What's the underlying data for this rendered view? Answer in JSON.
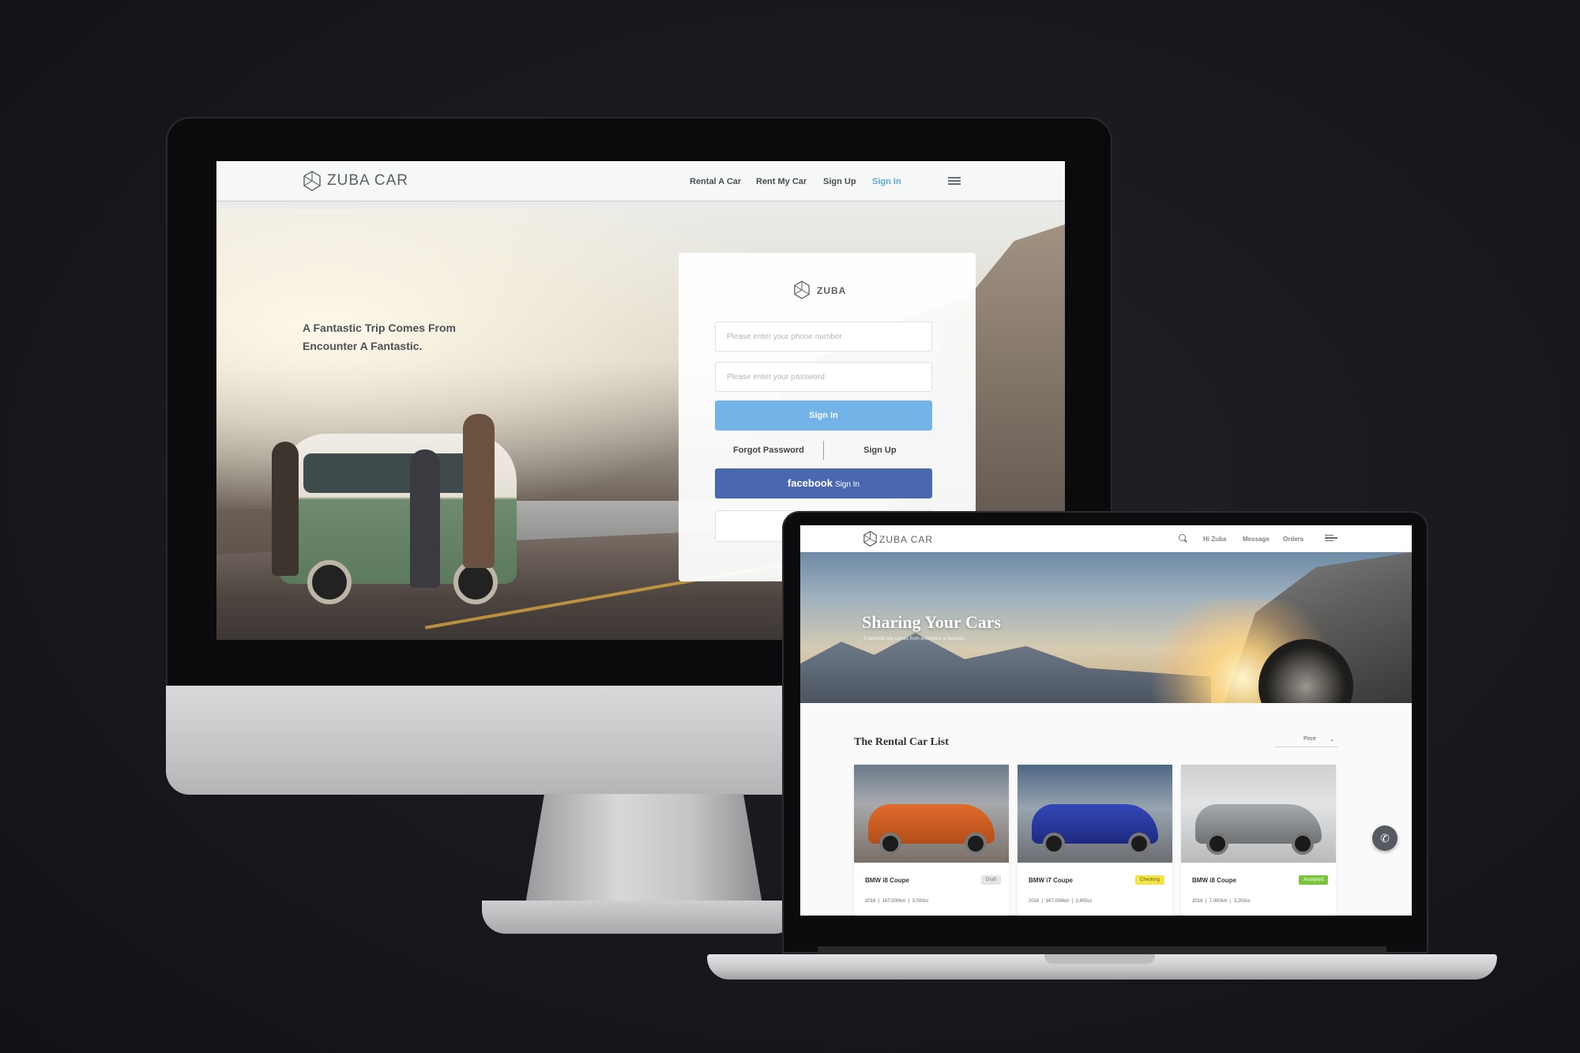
{
  "imac": {
    "brand": {
      "name": "ZUBA",
      "suffix": "CAR"
    },
    "nav": {
      "items": [
        {
          "label": "Rental A Car"
        },
        {
          "label": "Rent My Car"
        },
        {
          "label": "Sign Up"
        },
        {
          "label": "Sign In",
          "active": true
        }
      ],
      "menu_icon": "hamburger-icon"
    },
    "hero": {
      "line1": "A Fantastic Trip Comes From",
      "line2": "Encounter A Fantastic."
    },
    "login": {
      "brand": "ZUBA",
      "phone_placeholder": "Please enter your phone number",
      "password_placeholder": "Please enter your password",
      "sign_in_label": "Sign In",
      "forgot_label": "Forgot Password",
      "sign_up_label": "Sign Up",
      "facebook_brand": "facebook",
      "facebook_label": "Sign In",
      "colors": {
        "primary": "#74b3e8",
        "facebook": "#4a68b0"
      }
    }
  },
  "macbook": {
    "brand": {
      "name": "ZUBA",
      "suffix": "CAR"
    },
    "nav": {
      "search_icon": "search-icon",
      "items": [
        {
          "label": "Hi Zuba"
        },
        {
          "label": "Message"
        },
        {
          "label": "Orders"
        }
      ],
      "menu_icon": "hamburger-icon"
    },
    "hero": {
      "title": "Sharing Your Cars",
      "subtitle": "A fantastic trip comes from encounter a fantastic."
    },
    "list": {
      "title": "The Rental Car List",
      "sort_label": "Price",
      "cars": [
        {
          "name": "BMW i8 Coupe",
          "status": "Draft",
          "year": "2016",
          "mileage": "167,000km",
          "engine": "3,000cc",
          "status_color": "#e4e4e4",
          "status_text_color": "#777777"
        },
        {
          "name": "BMW i7 Coupe",
          "status": "Checking",
          "year": "2016",
          "mileage": "167,000km",
          "engine": "2,400cc",
          "status_color": "#f2e44a",
          "status_text_color": "#6b5f00"
        },
        {
          "name": "BMW i8 Coupe",
          "status": "Accepted",
          "year": "2016",
          "mileage": "7,000km",
          "engine": "3,200cc",
          "status_color": "#7cc43d",
          "status_text_color": "#ffffff"
        }
      ]
    },
    "phone_button_icon": "phone-icon"
  }
}
